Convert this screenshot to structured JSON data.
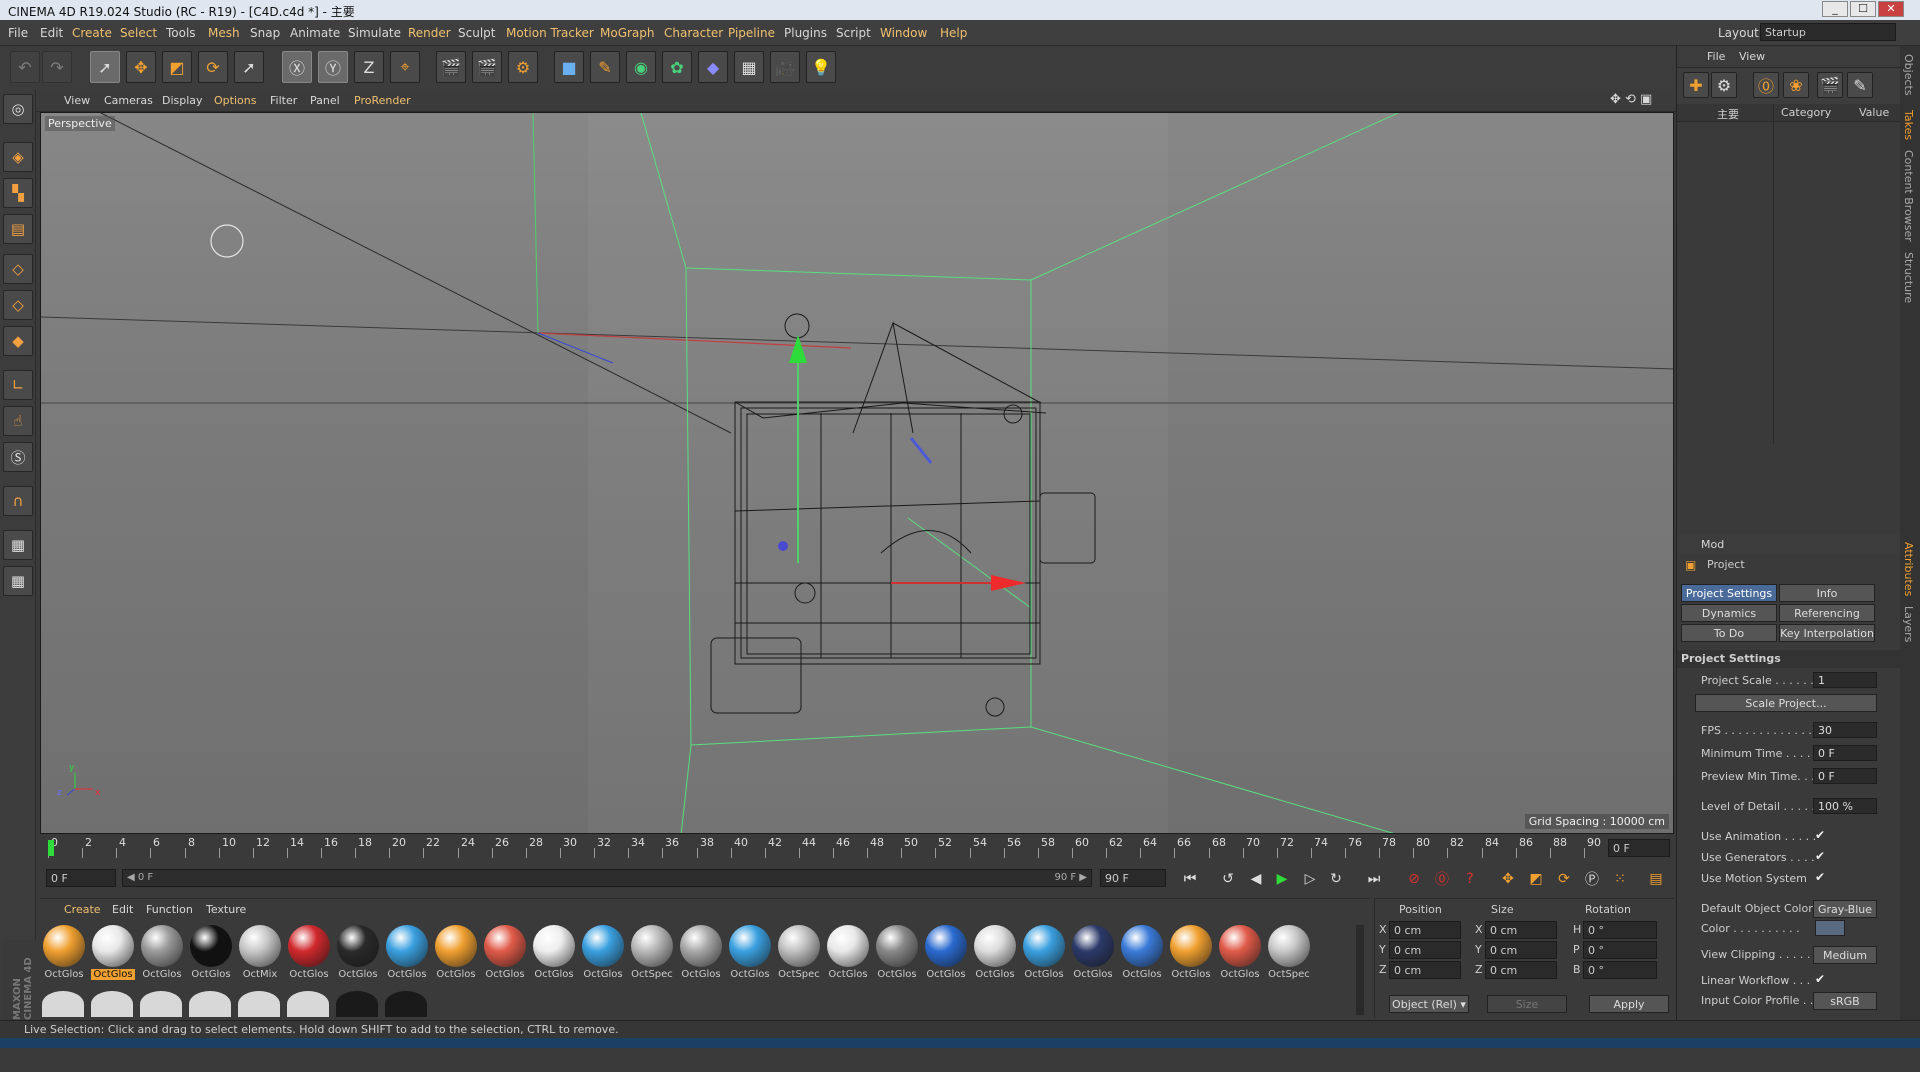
{
  "window": {
    "title": "CINEMA 4D R19.024 Studio (RC - R19) - [C4D.c4d *] - 主要",
    "min": "_",
    "max": "☐",
    "close": "✕"
  },
  "menu": [
    "File",
    "Edit",
    "Create",
    "Select",
    "Tools",
    "Mesh",
    "Snap",
    "Animate",
    "Simulate",
    "Render",
    "Sculpt",
    "Motion Tracker",
    "MoGraph",
    "Character",
    "Pipeline",
    "Plugins",
    "Script",
    "Window",
    "Help"
  ],
  "layout": {
    "label": "Layout:",
    "value": "Startup"
  },
  "viewport_menu": [
    "View",
    "Cameras",
    "Display",
    "Options",
    "Filter",
    "Panel",
    "ProRender"
  ],
  "viewport": {
    "label": "Perspective",
    "grid_spacing": "Grid Spacing : 10000 cm",
    "axis_y": "y",
    "axis_x": "x",
    "axis_z": "z"
  },
  "timeline": {
    "ticks": [
      "0",
      "2",
      "4",
      "6",
      "8",
      "10",
      "12",
      "14",
      "16",
      "18",
      "20",
      "22",
      "24",
      "26",
      "28",
      "30",
      "32",
      "34",
      "36",
      "38",
      "40",
      "42",
      "44",
      "46",
      "48",
      "50",
      "52",
      "54",
      "56",
      "58",
      "60",
      "62",
      "64",
      "66",
      "68",
      "70",
      "72",
      "74",
      "76",
      "78",
      "80",
      "82",
      "84",
      "86",
      "88",
      "90"
    ],
    "current": "0 F"
  },
  "time_controls": {
    "start": "0 F",
    "range_start": "◀ 0 F",
    "range_end": "90 F ▶",
    "end": "90 F"
  },
  "material_menu": [
    "Create",
    "Edit",
    "Function",
    "Texture"
  ],
  "materials": [
    {
      "label": "OctGlos",
      "color": "#f0a030"
    },
    {
      "label": "OctGlos",
      "color": "#e8e8e8",
      "selected": true
    },
    {
      "label": "OctGlos",
      "color": "#9a9a9a"
    },
    {
      "label": "OctGlos",
      "color": "#111111"
    },
    {
      "label": "OctMix",
      "color": "#c8c8c8"
    },
    {
      "label": "OctGlos",
      "color": "#d0282c"
    },
    {
      "label": "OctGlos",
      "color": "#2a2a2a"
    },
    {
      "label": "OctGlos",
      "color": "#3aa0e0"
    },
    {
      "label": "OctGlos",
      "color": "#f0a030"
    },
    {
      "label": "OctGlos",
      "color": "#e05a48"
    },
    {
      "label": "OctGlos",
      "color": "#eeeeee"
    },
    {
      "label": "OctGlos",
      "color": "#3aa0e0"
    },
    {
      "label": "OctSpec",
      "color": "#b8b8b8"
    },
    {
      "label": "OctGlos",
      "color": "#a8a8a8"
    },
    {
      "label": "OctGlos",
      "color": "#3aa0e0"
    },
    {
      "label": "OctSpec",
      "color": "#c0c0c0"
    },
    {
      "label": "OctGlos",
      "color": "#e8e8e8"
    },
    {
      "label": "OctGlos",
      "color": "#888888"
    },
    {
      "label": "OctGlos",
      "color": "#2a6ad0"
    },
    {
      "label": "OctGlos",
      "color": "#dddddd"
    },
    {
      "label": "OctGlos",
      "color": "#3aa0e0"
    },
    {
      "label": "OctGlos",
      "color": "#2c3a6a"
    },
    {
      "label": "OctGlos",
      "color": "#3a7ad8"
    },
    {
      "label": "OctGlos",
      "color": "#f0a030"
    },
    {
      "label": "OctGlos",
      "color": "#e05a48"
    },
    {
      "label": "OctSpec",
      "color": "#c8c8c8"
    }
  ],
  "coords": {
    "headers": [
      "Position",
      "Size",
      "Rotation"
    ],
    "rows": [
      {
        "a": "X",
        "p": "0 cm",
        "b": "X",
        "s": "0 cm",
        "c": "H",
        "r": "0 °"
      },
      {
        "a": "Y",
        "p": "0 cm",
        "b": "Y",
        "s": "0 cm",
        "c": "P",
        "r": "0 °"
      },
      {
        "a": "Z",
        "p": "0 cm",
        "b": "Z",
        "s": "0 cm",
        "c": "B",
        "r": "0 °"
      }
    ],
    "mode": "Object (Rel) ▾",
    "size_mode": "Size",
    "apply": "Apply"
  },
  "objects_panel": {
    "menu": [
      "File",
      "View"
    ],
    "tree_root": "主要",
    "col_category": "Category",
    "col_value": "Value"
  },
  "attributes": {
    "mode": "Mod",
    "title": "Project",
    "tabs": [
      "Project Settings",
      "Info",
      "Dynamics",
      "Referencing",
      "To Do",
      "Key Interpolation"
    ],
    "section": "Project Settings",
    "scale_project": "Scale Project...",
    "props": [
      {
        "label": "Project Scale . . . . . .",
        "value": "1"
      },
      {
        "label": "FPS . . . . . . . . . . . . . .",
        "value": "30"
      },
      {
        "label": "Minimum Time . . . .",
        "value": "0 F"
      },
      {
        "label": "Preview Min Time. . .",
        "value": "0 F"
      },
      {
        "label": "Level of Detail . . . . .",
        "value": "100 %"
      }
    ],
    "checks": [
      {
        "label": "Use Animation . . . . .",
        "mark": "✔"
      },
      {
        "label": "Use Generators . . . .",
        "mark": "✔"
      },
      {
        "label": "Use Motion System",
        "mark": "✔"
      }
    ],
    "default_color_label": "Default Object Color",
    "default_color_value": "Gray-Blue",
    "color_label": "Color . . . . . . . . . .",
    "view_clipping_label": "View Clipping . . . . .",
    "view_clipping_value": "Medium",
    "linear_workflow": "Linear Workflow . . .",
    "linear_mark": "✔",
    "input_color_profile": "Input Color Profile . .",
    "input_color_value": "sRGB"
  },
  "side_tabs": [
    "Objects",
    "Takes",
    "Content Browser",
    "Structure",
    "Attributes",
    "Layers"
  ],
  "status": "Live Selection: Click and drag to select elements. Hold down SHIFT to add to the selection, CTRL to remove.",
  "brand": "MAXON CINEMA 4D"
}
